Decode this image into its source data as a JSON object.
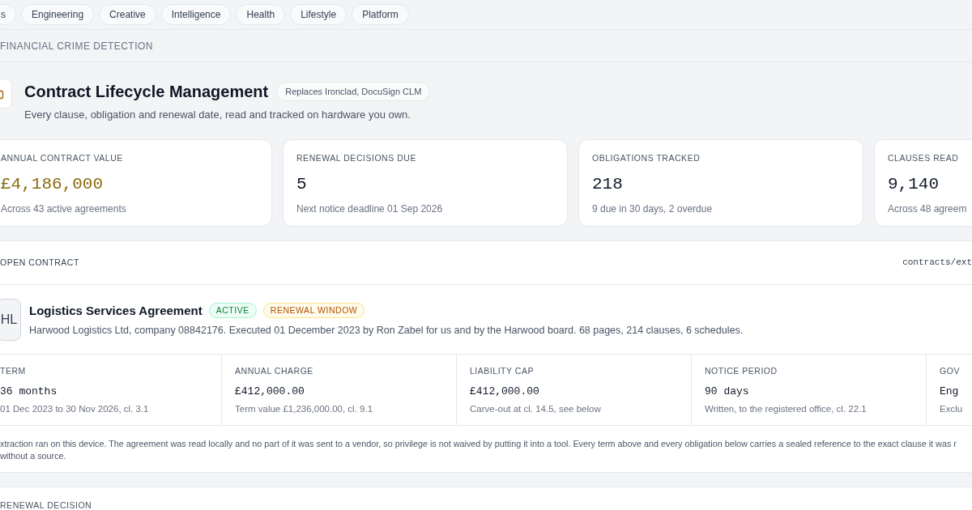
{
  "category_tabs": [
    {
      "label": "s",
      "selected": false
    },
    {
      "label": "Engineering",
      "selected": false
    },
    {
      "label": "Creative",
      "selected": false
    },
    {
      "label": "Intelligence",
      "selected": false
    },
    {
      "label": "Health",
      "selected": false
    },
    {
      "label": "Lifestyle",
      "selected": false
    },
    {
      "label": "Platform",
      "selected": false
    }
  ],
  "section_heading": "FINANCIAL CRIME DETECTION",
  "product": {
    "title": "Contract Lifecycle Management",
    "badge": "Replaces Ironclad, DocuSign CLM",
    "subtitle": "Every clause, obligation and renewal date, read and tracked on hardware you own."
  },
  "stats": [
    {
      "label": "ANNUAL CONTRACT VALUE",
      "value": "£4,186,000",
      "note": "Across 43 active agreements",
      "accent": true
    },
    {
      "label": "RENEWAL DECISIONS DUE",
      "value": "5",
      "note": "Next notice deadline 01 Sep 2026",
      "accent": false
    },
    {
      "label": "OBLIGATIONS TRACKED",
      "value": "218",
      "note": "9 due in 30 days, 2 overdue",
      "accent": false
    },
    {
      "label": "CLAUSES READ",
      "value": "9,140",
      "note": "Across 48 agreem",
      "accent": false
    }
  ],
  "open_contract": {
    "heading": "OPEN CONTRACT",
    "path": "contracts/ext",
    "avatar": "HL",
    "title": "Logistics Services Agreement",
    "badges": [
      {
        "label": "ACTIVE",
        "kind": "success"
      },
      {
        "label": "RENEWAL WINDOW",
        "kind": "warning"
      }
    ],
    "description": "Harwood Logistics Ltd, company 08842176. Executed 01 December 2023 by Ron Zabel for us and by the Harwood board. 68 pages, 214 clauses, 6 schedules.",
    "terms": [
      {
        "label": "TERM",
        "value": "36 months",
        "note": "01 Dec 2023 to 30 Nov 2026, cl. 3.1"
      },
      {
        "label": "ANNUAL CHARGE",
        "value": "£412,000.00",
        "note": "Term value £1,236,000.00, cl. 9.1"
      },
      {
        "label": "LIABILITY CAP",
        "value": "£412,000.00",
        "note": "Carve-out at cl. 14.5, see below"
      },
      {
        "label": "NOTICE PERIOD",
        "value": "90 days",
        "note": "Written, to the registered office, cl. 22.1"
      },
      {
        "label": "GOV",
        "value": "Eng",
        "note": "Exclu"
      }
    ],
    "note_lines": [
      "xtraction ran on this device. The agreement was read locally and no part of it was sent to a vendor, so privilege is not waived by putting it into a tool. Every term above and every obligation below carries a sealed reference to the exact clause it was r",
      "without a source."
    ]
  },
  "renewal_decision": {
    "heading": "RENEWAL DECISION"
  }
}
